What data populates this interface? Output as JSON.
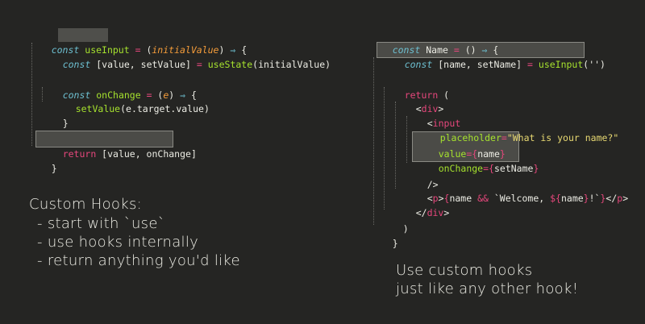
{
  "left_code": {
    "l1": {
      "const": "const",
      "name": "useInput",
      "eq": " = ",
      "open": "(",
      "param": "initialValue",
      "close": ")",
      "arrow": " ⇒ ",
      "brace": "{"
    },
    "l2": {
      "const": "const",
      "rest": " [value, setValue] ",
      "eq": "= ",
      "fn": "useState",
      "args": "(initialValue)"
    },
    "l4": {
      "const": "const",
      "name": " onChange",
      "eq": " = ",
      "open": "(",
      "param": "e",
      "close": ")",
      "arrow": " ⇒ ",
      "brace": "{"
    },
    "l5": {
      "fn": "setValue",
      "args": "(e.target.value)"
    },
    "l6": {
      "text": "}"
    },
    "l8": {
      "kw": "return",
      "rest": " [value, onChange]"
    },
    "l9": {
      "text": "}"
    }
  },
  "right_code": {
    "l1": {
      "const": "const",
      "name": " Name",
      "eq": " = ",
      "parens": "()",
      "arrow": " ⇒ ",
      "brace": "{"
    },
    "l2": {
      "const": "const",
      "rest": " [name, setName] ",
      "eq": "= ",
      "fn": "useInput",
      "args": "('')"
    },
    "l4": {
      "kw": "return",
      "rest": " ("
    },
    "l5": {
      "lt": "<",
      "tag": "div",
      "gt": ">"
    },
    "l6": {
      "lt": "<",
      "tag": "input"
    },
    "l7": {
      "attr": "placeholder",
      "eq": "=",
      "str": "\"What is your name?\""
    },
    "l8": {
      "attr": "value",
      "eq": "=",
      "ob": "{",
      "val": "name",
      "cb": "}"
    },
    "l9": {
      "attr": "onChange",
      "eq": "=",
      "ob": "{",
      "val": "setName",
      "cb": "}"
    },
    "l10": {
      "text": "/>"
    },
    "l11": {
      "lt": "<",
      "tag": "p",
      "gt": ">",
      "ob": "{",
      "expr1": "name ",
      "amp": "&&",
      "tpl1": " `Welcome, ",
      "dol": "${",
      "expr2": "name",
      "cb2": "}",
      "tpl2": "!`",
      "cb": "}",
      "close": "</",
      "ctag": "p",
      "cgt": ">"
    },
    "l12": {
      "close": "</",
      "tag": "div",
      "gt": ">"
    },
    "l13": {
      "text": ")"
    },
    "l14": {
      "text": "}"
    }
  },
  "notes": {
    "left_title": "Custom Hooks:",
    "left_items": [
      "- start with `use`",
      "- use hooks internally",
      "- return anything you'd like"
    ],
    "right_line1": "Use custom hooks",
    "right_line2": "just like any other hook!"
  }
}
